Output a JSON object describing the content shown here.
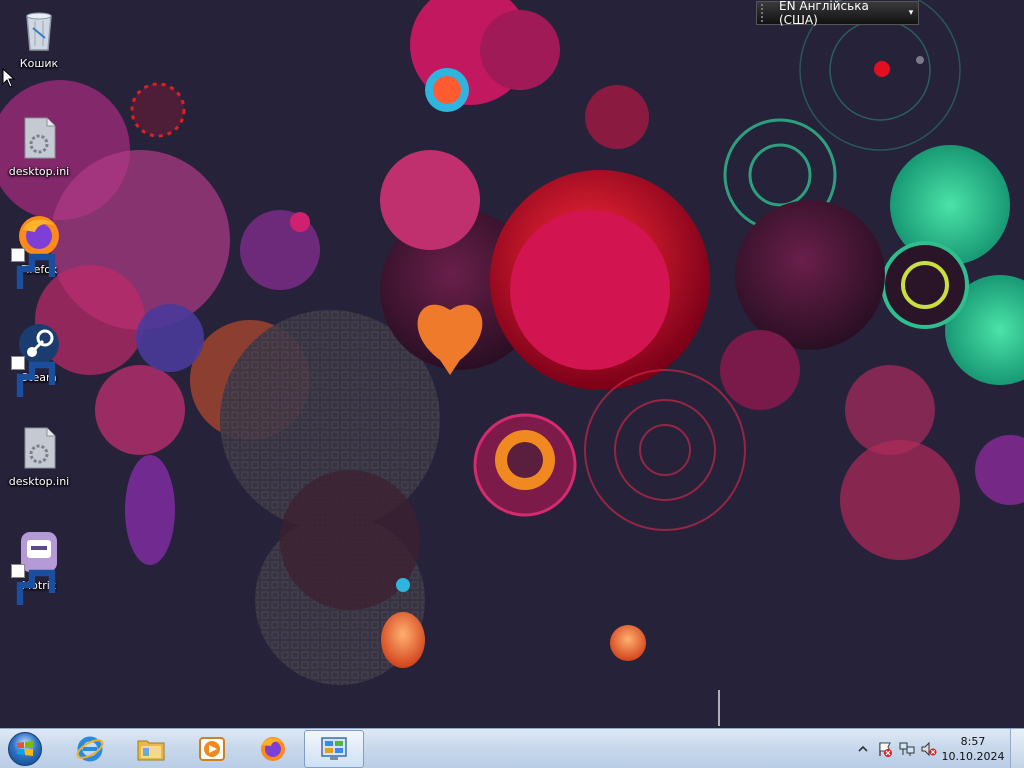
{
  "desktop": {
    "icons": [
      {
        "label": "Кошик",
        "icon": "recycle-bin-icon",
        "shortcut": false
      },
      {
        "label": "desktop.ini",
        "icon": "config-file-icon",
        "shortcut": false
      },
      {
        "label": "Firefox",
        "icon": "firefox-icon",
        "shortcut": true
      },
      {
        "label": "Steam",
        "icon": "steam-icon",
        "shortcut": true
      },
      {
        "label": "desktop.ini",
        "icon": "config-file-icon",
        "shortcut": false
      },
      {
        "label": "Motrix",
        "icon": "motrix-icon",
        "shortcut": true
      }
    ]
  },
  "language_bar": {
    "text": "EN Англійська (США)"
  },
  "taskbar": {
    "start": "windows-start-orb-icon",
    "pinned": [
      {
        "app": "Internet Explorer",
        "icon": "internet-explorer-icon",
        "active": false
      },
      {
        "app": "Windows Explorer",
        "icon": "folder-explorer-icon",
        "active": false
      },
      {
        "app": "Windows Media Player",
        "icon": "media-player-icon",
        "active": false
      },
      {
        "app": "Firefox",
        "icon": "firefox-icon",
        "active": false
      },
      {
        "app": "Control Panel",
        "icon": "control-panel-icon",
        "active": true
      }
    ],
    "tray": {
      "icons": [
        "show-hidden-icons-chevron",
        "action-center-flag-icon",
        "network-icon",
        "volume-muted-icon"
      ],
      "time": "8:57",
      "date": "10.10.2024"
    }
  },
  "colors": {
    "wallpaper_base": "#26223a",
    "magenta": "#c2185b",
    "red": "#e0102a",
    "teal": "#2fbf8f",
    "orange": "#f07a2c",
    "taskbar": "#c9d9ec"
  }
}
